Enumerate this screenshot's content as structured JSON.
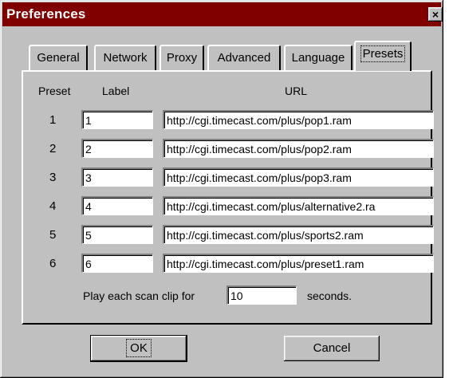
{
  "window": {
    "title": "Preferences",
    "close_label": "×"
  },
  "tabs": [
    {
      "label": "General"
    },
    {
      "label": "Network"
    },
    {
      "label": "Proxy"
    },
    {
      "label": "Advanced"
    },
    {
      "label": "Language"
    },
    {
      "label": "Presets",
      "active": true
    }
  ],
  "presets": {
    "headers": {
      "preset": "Preset",
      "label": "Label",
      "url": "URL"
    },
    "rows": [
      {
        "number": "1",
        "label": "1",
        "url": "http://cgi.timecast.com/plus/pop1.ram"
      },
      {
        "number": "2",
        "label": "2",
        "url": "http://cgi.timecast.com/plus/pop2.ram"
      },
      {
        "number": "3",
        "label": "3",
        "url": "http://cgi.timecast.com/plus/pop3.ram"
      },
      {
        "number": "4",
        "label": "4",
        "url": "http://cgi.timecast.com/plus/alternative2.ra"
      },
      {
        "number": "5",
        "label": "5",
        "url": "http://cgi.timecast.com/plus/sports2.ram"
      },
      {
        "number": "6",
        "label": "6",
        "url": "http://cgi.timecast.com/plus/preset1.ram"
      }
    ],
    "scan": {
      "prefix": "Play each scan clip for",
      "value": "10",
      "suffix": "seconds."
    }
  },
  "buttons": {
    "ok": "OK",
    "cancel": "Cancel"
  },
  "colors": {
    "titlebar": "#800000",
    "face": "#c0c0c0"
  }
}
